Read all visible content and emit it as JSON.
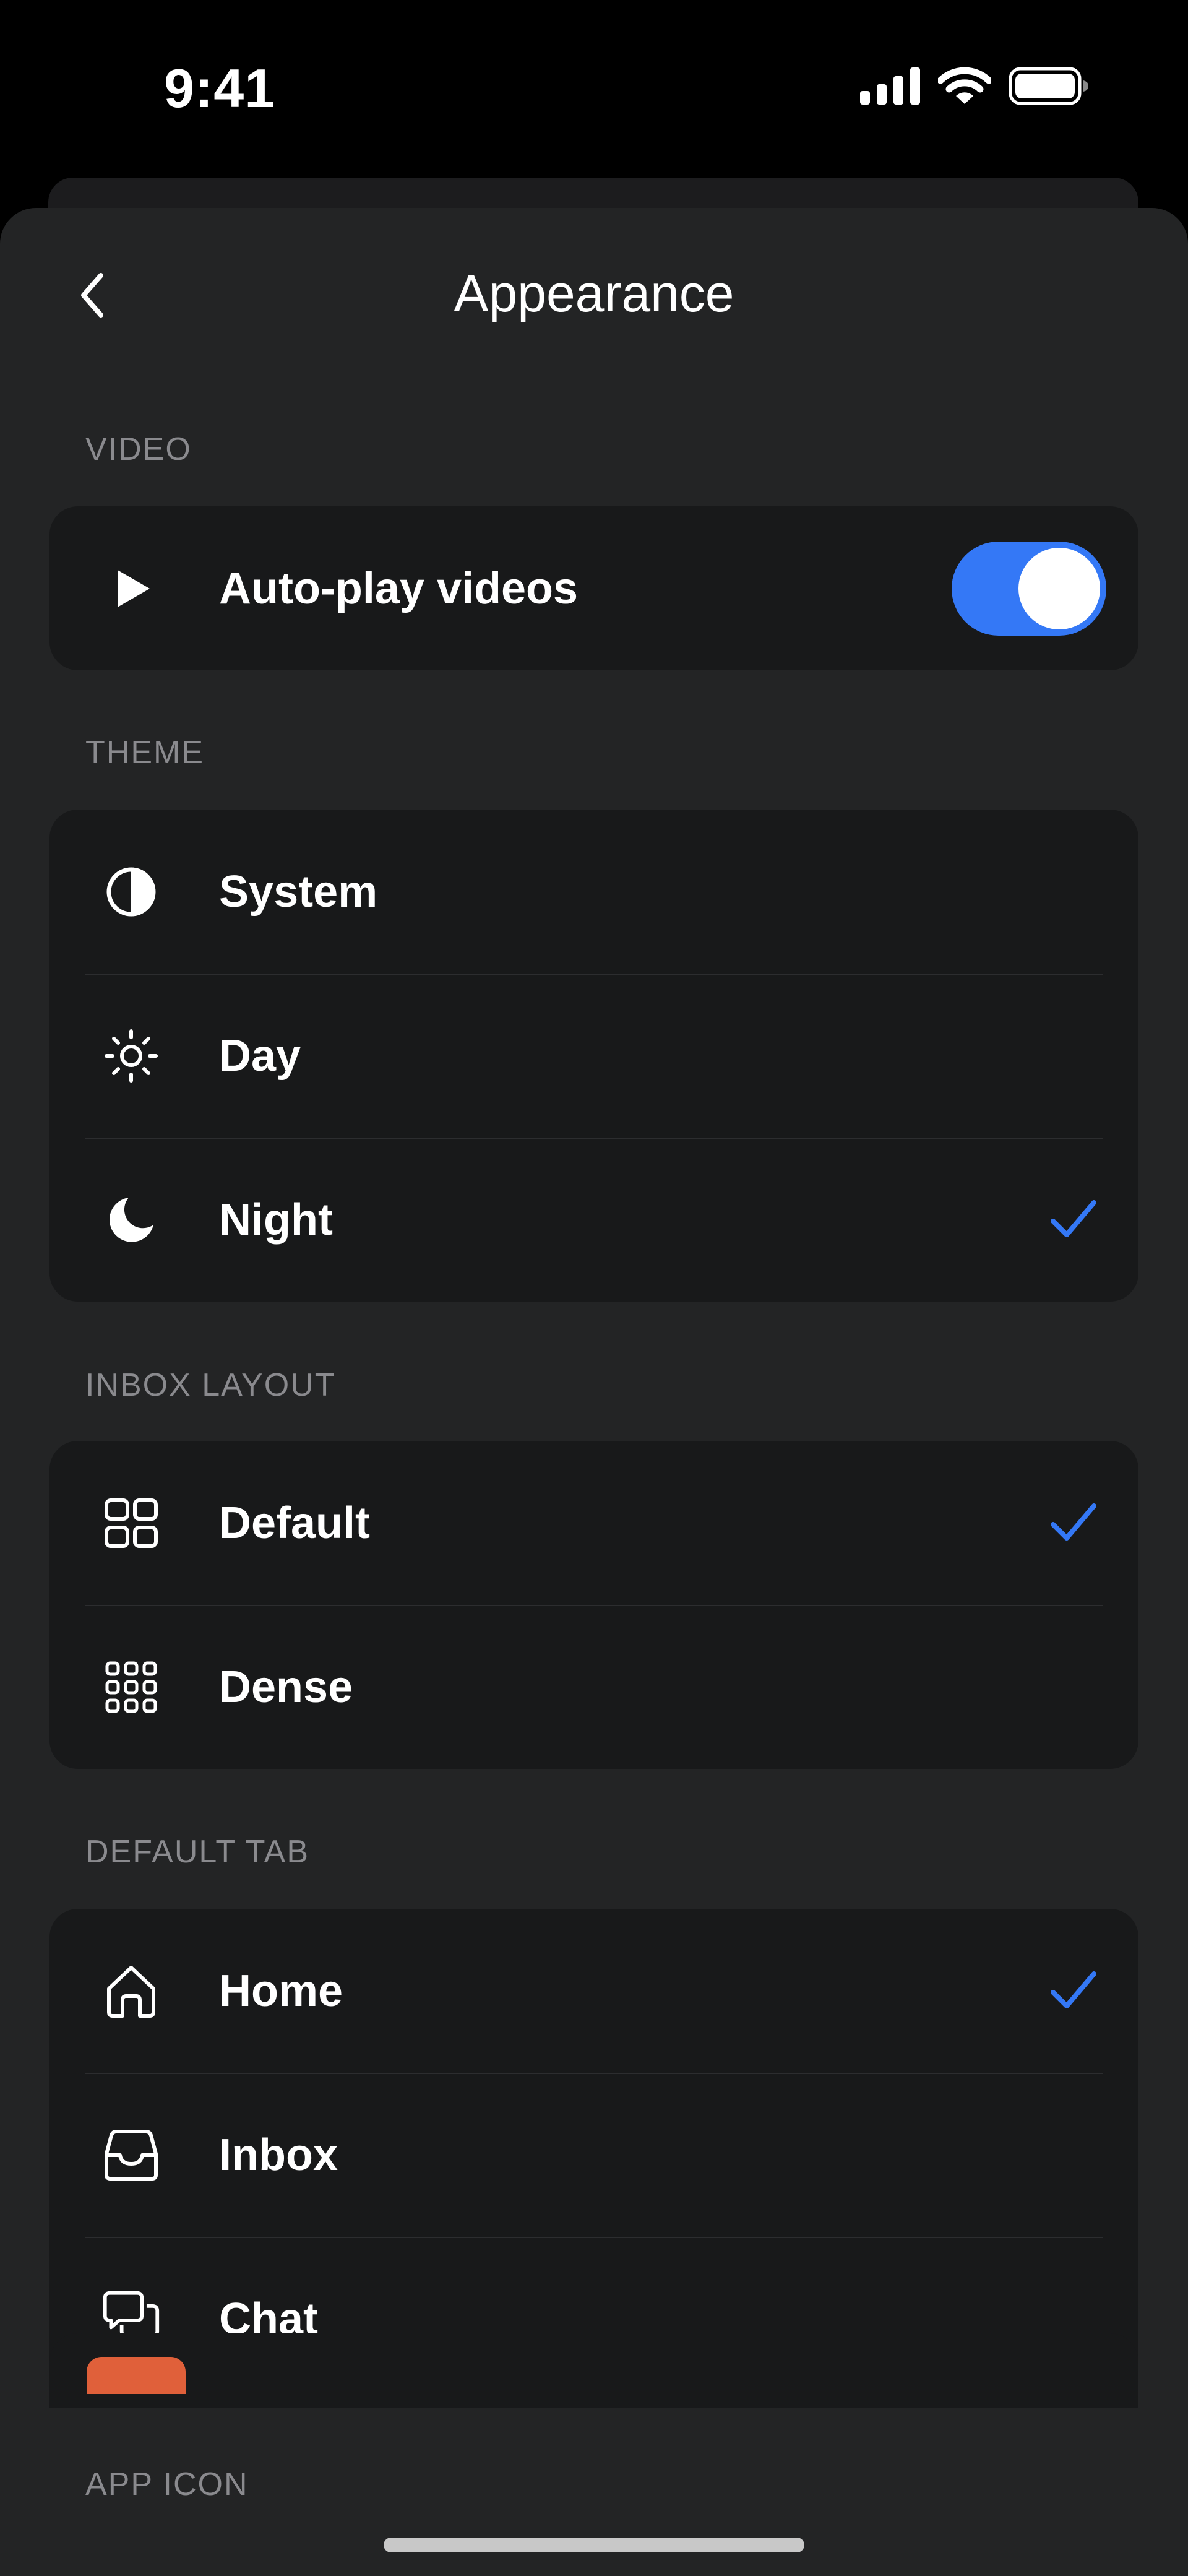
{
  "status_bar": {
    "time": "9:41"
  },
  "nav": {
    "title": "Appearance",
    "back_icon": "chevron-left-icon"
  },
  "sections": {
    "video": {
      "label": "VIDEO",
      "autoplay": {
        "label": "Auto-play videos",
        "icon": "play-icon",
        "enabled": true
      }
    },
    "theme": {
      "label": "THEME",
      "items": [
        {
          "label": "System",
          "icon": "contrast-icon",
          "selected": false
        },
        {
          "label": "Day",
          "icon": "sun-icon",
          "selected": false
        },
        {
          "label": "Night",
          "icon": "moon-icon",
          "selected": true
        }
      ]
    },
    "inbox_layout": {
      "label": "INBOX LAYOUT",
      "items": [
        {
          "label": "Default",
          "icon": "grid-icon",
          "selected": true
        },
        {
          "label": "Dense",
          "icon": "dense-grid-icon",
          "selected": false
        }
      ]
    },
    "default_tab": {
      "label": "DEFAULT TAB",
      "items": [
        {
          "label": "Home",
          "icon": "home-icon",
          "selected": true
        },
        {
          "label": "Inbox",
          "icon": "inbox-icon",
          "selected": false
        },
        {
          "label": "Chat",
          "icon": "chat-icon",
          "selected": false
        }
      ]
    },
    "app_icon": {
      "label": "APP ICON"
    }
  },
  "colors": {
    "accent": "#3478f6",
    "background": "#232425",
    "card": "#18191a",
    "section_label": "#8a8a8e"
  }
}
